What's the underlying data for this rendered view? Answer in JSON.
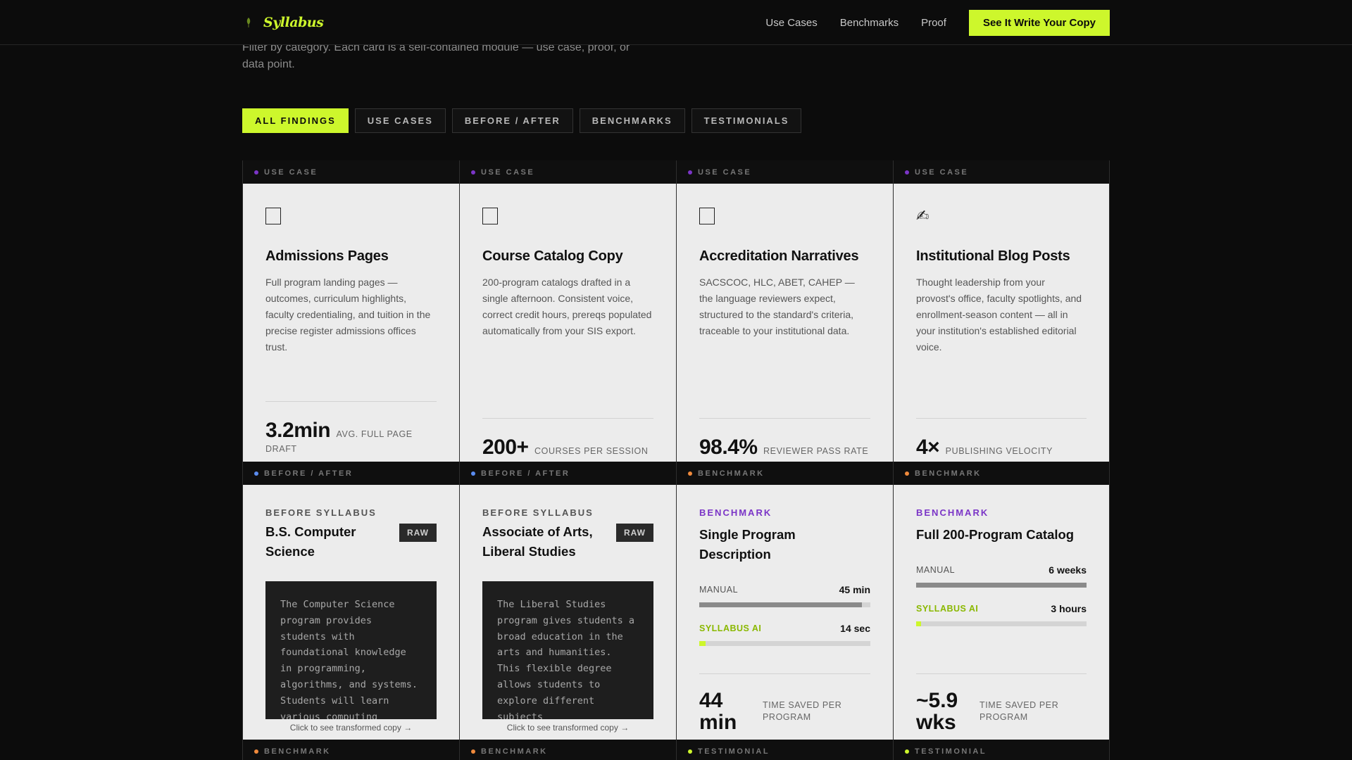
{
  "nav": {
    "brand": "Syllabus",
    "links": [
      "Use Cases",
      "Benchmarks",
      "Proof"
    ],
    "cta": "See It Write Your Copy"
  },
  "intro": {
    "text": "Filter by category. Each card is a self-contained module — use case, proof, or data point."
  },
  "filters": [
    "ALL FINDINGS",
    "USE CASES",
    "BEFORE / AFTER",
    "BENCHMARKS",
    "TESTIMONIALS"
  ],
  "colors": {
    "accent": "#cdf72c",
    "use_case_dot": "#7b35c7",
    "before_after_dot": "#5b8cf0",
    "benchmark_dot": "#f08a3c",
    "testimonial_dot": "#cdf72c"
  },
  "use_cases": [
    {
      "tag": "USE CASE",
      "icon": "document-icon",
      "title": "Admissions Pages",
      "desc": "Full program landing pages — outcomes, curriculum highlights, faculty credentialing, and tuition in the precise register admissions offices trust.",
      "stat_value": "3.2min",
      "stat_label": "AVG. FULL PAGE DRAFT"
    },
    {
      "tag": "USE CASE",
      "icon": "book-icon",
      "title": "Course Catalog Copy",
      "desc": "200-program catalogs drafted in a single afternoon. Consistent voice, correct credit hours, prereqs populated automatically from your SIS export.",
      "stat_value": "200+",
      "stat_label": "COURSES PER SESSION"
    },
    {
      "tag": "USE CASE",
      "icon": "clipboard-icon",
      "title": "Accreditation Narratives",
      "desc": "SACSCOC, HLC, ABET, CAHEP — the language reviewers expect, structured to the standard's criteria, traceable to your institutional data.",
      "stat_value": "98.4%",
      "stat_label": "REVIEWER PASS RATE"
    },
    {
      "tag": "USE CASE",
      "icon": "pen-icon",
      "icon_glyph": "✍",
      "title": "Institutional Blog Posts",
      "desc": "Thought leadership from your provost's office, faculty spotlights, and enrollment-season content — all in your institution's established editorial voice.",
      "stat_value": "4×",
      "stat_label": "PUBLISHING VELOCITY"
    }
  ],
  "before_after": [
    {
      "tag": "BEFORE / AFTER",
      "kicker": "BEFORE SYLLABUS",
      "title": "B.S. Computer Science",
      "badge": "RAW",
      "raw": "The Computer Science program provides students with foundational knowledge in programming, algorithms, and systems. Students will learn various computing",
      "hint": "Click to see transformed copy →"
    },
    {
      "tag": "BEFORE / AFTER",
      "kicker": "BEFORE SYLLABUS",
      "title": "Associate of Arts, Liberal Studies",
      "badge": "RAW",
      "raw": "The Liberal Studies program gives students a broad education in the arts and humanities. This flexible degree allows students to explore different subjects",
      "hint": "Click to see transformed copy →"
    }
  ],
  "benchmarks": [
    {
      "tag": "BENCHMARK",
      "kicker": "BENCHMARK",
      "title": "Single Program Description",
      "manual_label": "MANUAL",
      "manual_value": "45 min",
      "manual_fill": 0.95,
      "ai_label": "SYLLABUS AI",
      "ai_value": "14 sec",
      "ai_fill": 0.035,
      "saved_value": "44 min",
      "saved_label": "TIME SAVED PER PROGRAM"
    },
    {
      "tag": "BENCHMARK",
      "kicker": "BENCHMARK",
      "title": "Full 200-Program Catalog",
      "manual_label": "MANUAL",
      "manual_value": "6 weeks",
      "manual_fill": 1.0,
      "ai_label": "SYLLABUS AI",
      "ai_value": "3 hours",
      "ai_fill": 0.03,
      "saved_value": "~5.9 wks",
      "saved_label": "TIME SAVED PER PROGRAM"
    }
  ],
  "row3": [
    {
      "tag": "BENCHMARK",
      "dot": "benchmark_dot"
    },
    {
      "tag": "BENCHMARK",
      "dot": "benchmark_dot"
    },
    {
      "tag": "TESTIMONIAL",
      "dot": "testimonial_dot"
    },
    {
      "tag": "TESTIMONIAL",
      "dot": "testimonial_dot"
    }
  ]
}
